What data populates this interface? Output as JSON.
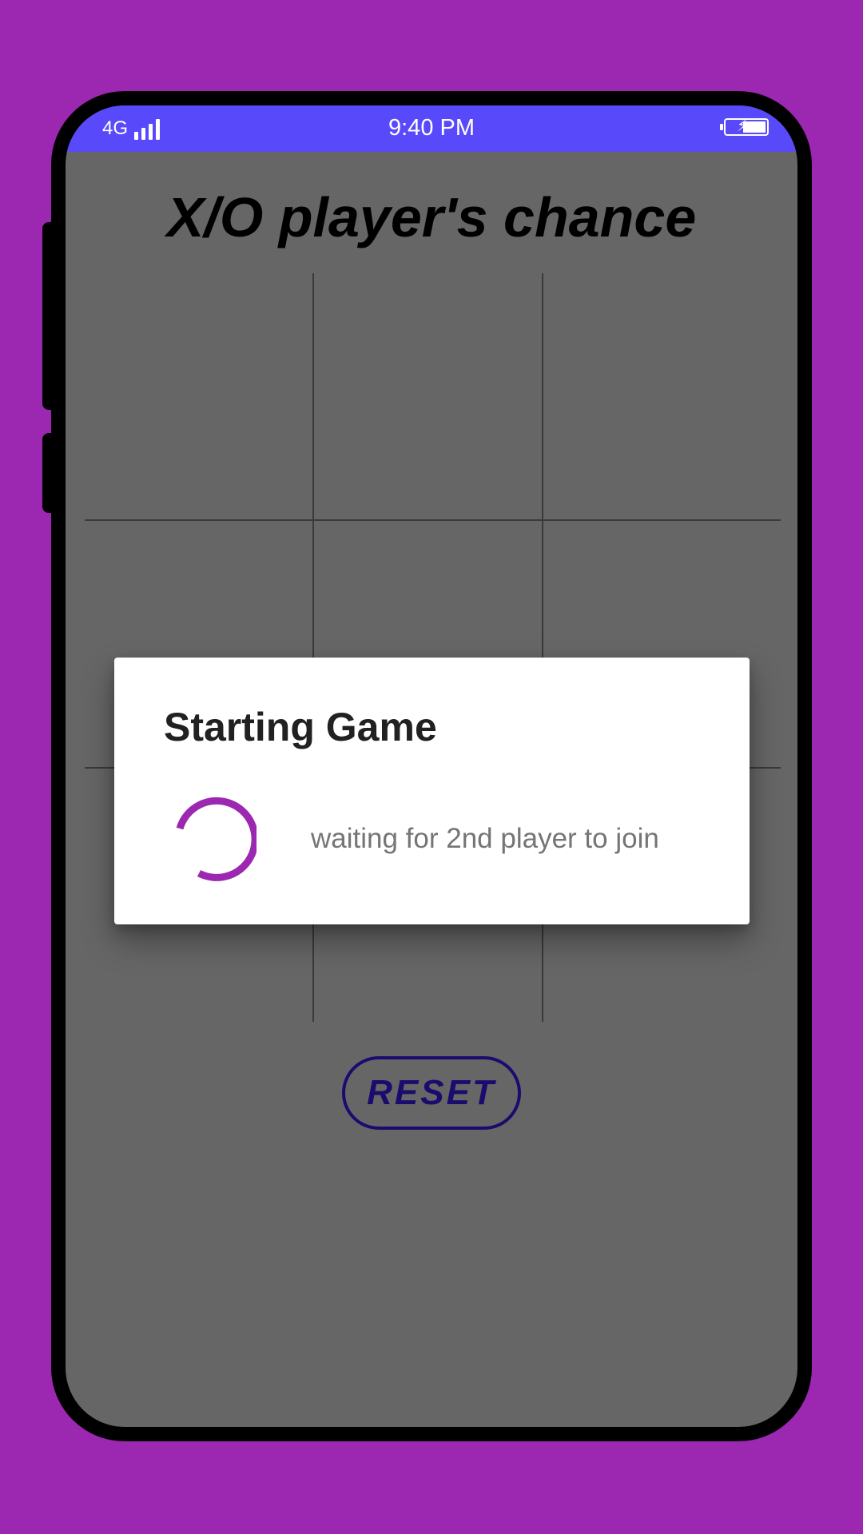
{
  "status_bar": {
    "network": "4G",
    "signal_icon": "signal-bars-icon",
    "time": "9:40 PM",
    "battery_icon": "battery-charging-icon",
    "background": "#584AFB"
  },
  "game": {
    "title": "X/O player's chance",
    "board_cells": [
      "",
      "",
      "",
      "",
      "",
      "",
      "",
      "",
      ""
    ],
    "reset_label": "RESET"
  },
  "dialog": {
    "title": "Starting Game",
    "message": "waiting for 2nd player to join",
    "spinner_icon": "loading-spinner-icon",
    "accent": "#9C27B0"
  },
  "colors": {
    "background": "#9C27B0",
    "scrim": "#666666",
    "reset_border": "#1A0C6E"
  }
}
